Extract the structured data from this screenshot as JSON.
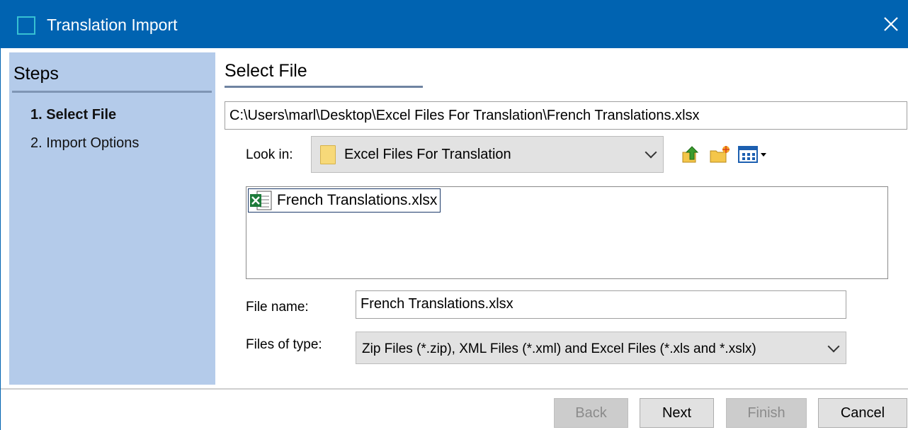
{
  "window": {
    "title": "Translation Import",
    "accent_color": "#0063b1",
    "close_icon": "close-icon"
  },
  "steps": {
    "title": "Steps",
    "items": [
      {
        "label": "1. Select File",
        "active": true
      },
      {
        "label": "2. Import Options",
        "active": false
      }
    ]
  },
  "main": {
    "title": "Select File",
    "path": "C:\\Users\\marl\\Desktop\\Excel Files For Translation\\French Translations.xlsx",
    "look_in": {
      "label": "Look in:",
      "value": "Excel Files For Translation",
      "icon": "folder-icon"
    },
    "toolbar": {
      "up_icon": "up-folder-icon",
      "new_folder_icon": "new-folder-icon",
      "view_icon": "view-menu-icon"
    },
    "files": [
      {
        "name": "French Translations.xlsx",
        "icon": "excel-file-icon"
      }
    ],
    "file_name": {
      "label": "File name:",
      "value": "French Translations.xlsx"
    },
    "file_type": {
      "label": "Files of type:",
      "value": "Zip Files (*.zip), XML Files (*.xml) and Excel Files (*.xls and *.xslx)"
    }
  },
  "footer": {
    "back": "Back",
    "next": "Next",
    "finish": "Finish",
    "cancel": "Cancel"
  }
}
